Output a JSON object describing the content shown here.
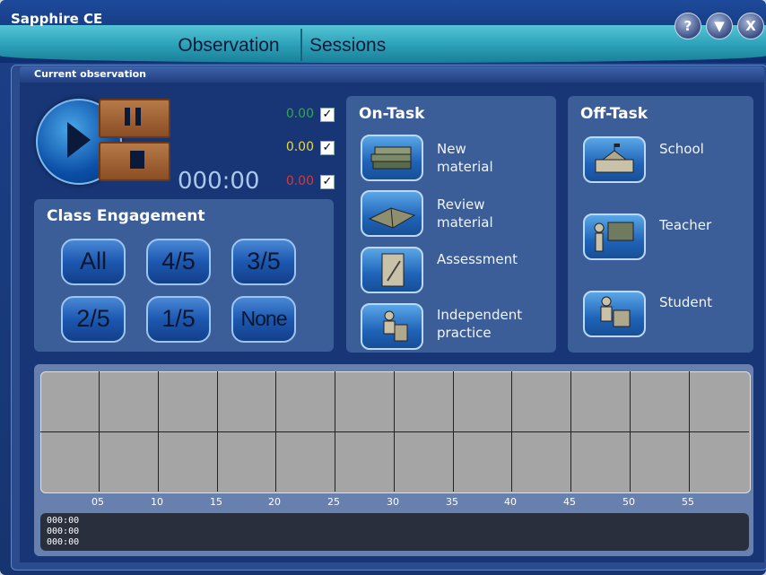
{
  "app": {
    "title": "Sapphire CE"
  },
  "window_buttons": {
    "help": "?",
    "minimize": "▼",
    "close": "X"
  },
  "tabs": [
    {
      "label": "Observation"
    },
    {
      "label": "Sessions"
    }
  ],
  "section": {
    "title": "Current observation"
  },
  "playback": {
    "elapsed": "000:00",
    "counters": [
      {
        "value": "0.00",
        "color": "#2fa94a",
        "checked": true
      },
      {
        "value": "0.00",
        "color": "#e6d93a",
        "checked": true
      },
      {
        "value": "0.00",
        "color": "#d43a3a",
        "checked": true
      }
    ],
    "check_mark": "✓"
  },
  "engagement": {
    "title": "Class Engagement",
    "buttons": [
      "All",
      "4/5",
      "3/5",
      "2/5",
      "1/5",
      "None"
    ]
  },
  "on_task": {
    "title": "On-Task",
    "items": [
      {
        "line1": "New",
        "line2": "material",
        "icon": "books-icon"
      },
      {
        "line1": "Review",
        "line2": "material",
        "icon": "open-book-icon"
      },
      {
        "line1": "Assessment",
        "line2": "",
        "icon": "paper-pencil-icon"
      },
      {
        "line1": "Independent",
        "line2": "practice",
        "icon": "student-desk-icon"
      }
    ]
  },
  "off_task": {
    "title": "Off-Task",
    "items": [
      {
        "label": "School",
        "icon": "school-building-icon"
      },
      {
        "label": "Teacher",
        "icon": "teacher-board-icon"
      },
      {
        "label": "Student",
        "icon": "student-icon"
      }
    ]
  },
  "timeline": {
    "ticks": [
      "05",
      "10",
      "15",
      "20",
      "25",
      "30",
      "35",
      "40",
      "45",
      "50",
      "55"
    ],
    "log": [
      "000:00",
      "000:00",
      "000:00"
    ]
  }
}
